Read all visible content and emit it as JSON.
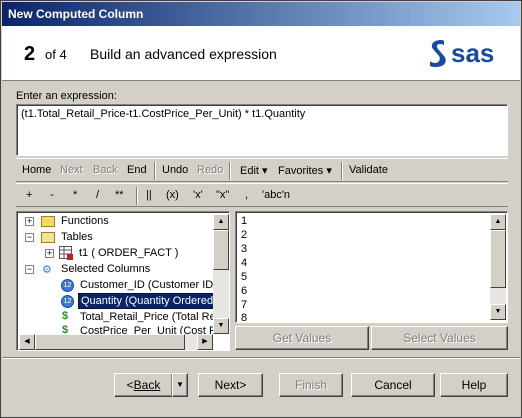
{
  "window": {
    "title": "New Computed Column"
  },
  "header": {
    "step_num": "2",
    "step_of": "of 4",
    "step_title": "Build an advanced expression",
    "logo_text": "sas"
  },
  "expression": {
    "label": "Enter an expression:",
    "value": "(t1.Total_Retail_Price-t1.CostPrice_Per_Unit) * t1.Quantity"
  },
  "toolbar1": {
    "home": "Home",
    "next": "Next",
    "back": "Back",
    "end": "End",
    "undo": "Undo",
    "redo": "Redo",
    "edit": "Edit",
    "favorites": "Favorites",
    "validate": "Validate"
  },
  "operators": [
    "+",
    "-",
    "*",
    "/",
    "**",
    "||",
    "(x)",
    "'x'",
    "\"x\"",
    ",",
    "'abc'n"
  ],
  "tree": {
    "functions": "Functions",
    "tables": "Tables",
    "t1": "t1 ( ORDER_FACT )",
    "selected_columns": "Selected Columns",
    "col1": "Customer_ID (Customer ID)",
    "col2": "Quantity (Quantity Ordered)",
    "col3": "Total_Retail_Price (Total Re",
    "col4": "CostPrice_Per_Unit (Cost Pr"
  },
  "values_list": [
    "1",
    "2",
    "3",
    "4",
    "5",
    "6",
    "7",
    "8"
  ],
  "value_buttons": {
    "get_values": "Get Values",
    "select_values": "Select Values"
  },
  "footer": {
    "back": "Back",
    "next": "Next>",
    "finish": "Finish",
    "cancel": "Cancel",
    "help": "Help"
  }
}
